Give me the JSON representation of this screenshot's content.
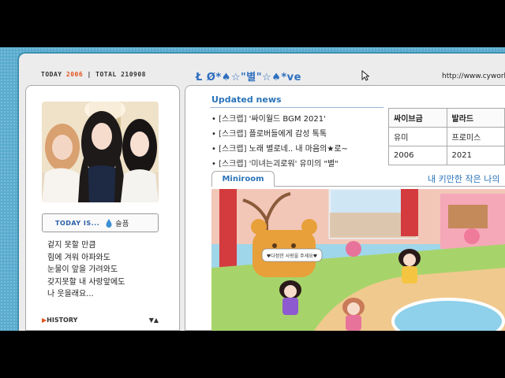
{
  "header": {
    "today_label": "TODAY",
    "today_count": "2006",
    "separator": "|",
    "total_label": "TOTAL",
    "total_count": "210908",
    "nickname": "Ł Ø*♠☆\"별\"☆♠*ve",
    "url": "http://www.cyworld"
  },
  "profile": {
    "today_is_label": "TODAY IS...",
    "mood_icon": "water-drop-icon",
    "mood_text": "슬픔",
    "diary_lines": [
      "겉지 못할 만큼",
      "힘에 겨워 아파와도",
      "눈물이 앞을 가려와도",
      "갖지못할 내 사랑앞에도",
      "나 웃을래요..."
    ],
    "history_label": "HISTORY"
  },
  "news": {
    "title": "Updated news",
    "items": [
      {
        "cat": "[스크랩]",
        "text": "'싸이월드 BGM 2021'"
      },
      {
        "cat": "[스크랩]",
        "text": "플로버들에게 감성 톡톡"
      },
      {
        "cat": "[스크랩]",
        "text": "노래 별로네.. 내 마음의★로~"
      },
      {
        "cat": "[스크랩]",
        "text": "'미녀는괴로워' 유미의 \"별\""
      }
    ]
  },
  "info_table": {
    "rows": [
      [
        "싸이브금",
        "발라드"
      ],
      [
        "유미",
        "프로미스"
      ],
      [
        "2006",
        "2021"
      ]
    ]
  },
  "miniroom": {
    "tab_label": "Miniroom",
    "caption": "내 키만한 작은 나의",
    "speech_bubble": "♥다정한 사랑을 주세요♥"
  },
  "colors": {
    "frame_blue": "#5aaccf",
    "title_blue": "#2a73b8",
    "accent_orange": "#e2531d"
  }
}
